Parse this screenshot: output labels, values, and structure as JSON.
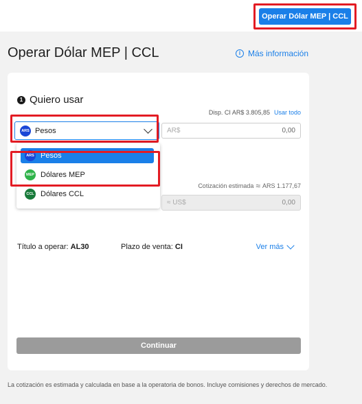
{
  "header": {
    "operate_button": "Operar Dólar MEP | CCL"
  },
  "page": {
    "title": "Operar Dólar MEP | CCL",
    "more_info": "Más información"
  },
  "form": {
    "step_number": "1",
    "section_title": "Quiero usar",
    "available": "Disp. CI AR$ 3.805,85",
    "use_all": "Usar todo",
    "selected_currency": {
      "code": "ARS",
      "label": "Pesos"
    },
    "amount_prefix": "AR$",
    "amount_value": "0,00",
    "dropdown_options": [
      {
        "code": "ARS",
        "label": "Pesos",
        "selected": true
      },
      {
        "code": "MEP",
        "label": "Dólares MEP",
        "selected": false
      },
      {
        "code": "CCL",
        "label": "Dólares CCL",
        "selected": false
      }
    ],
    "estimated_rate_label": "Cotización estimada",
    "estimated_rate_value": "ARS 1.177,67",
    "output_prefix": "≈ US$",
    "output_value": "0,00",
    "title_label": "Título a operar:",
    "title_value": "AL30",
    "term_label": "Plazo de venta:",
    "term_value": "CI",
    "see_more": "Ver más",
    "continue": "Continuar"
  },
  "footnote": "La cotización es estimada y calculada en base a la operatoria de bonos. Incluye comisiones y derechos de mercado.",
  "colors": {
    "accent": "#1a7fe8",
    "highlight_frame": "#e31b23",
    "ars_badge": "#1a46d6",
    "mep_badge": "#2fb34a",
    "ccl_badge": "#187a3a"
  }
}
